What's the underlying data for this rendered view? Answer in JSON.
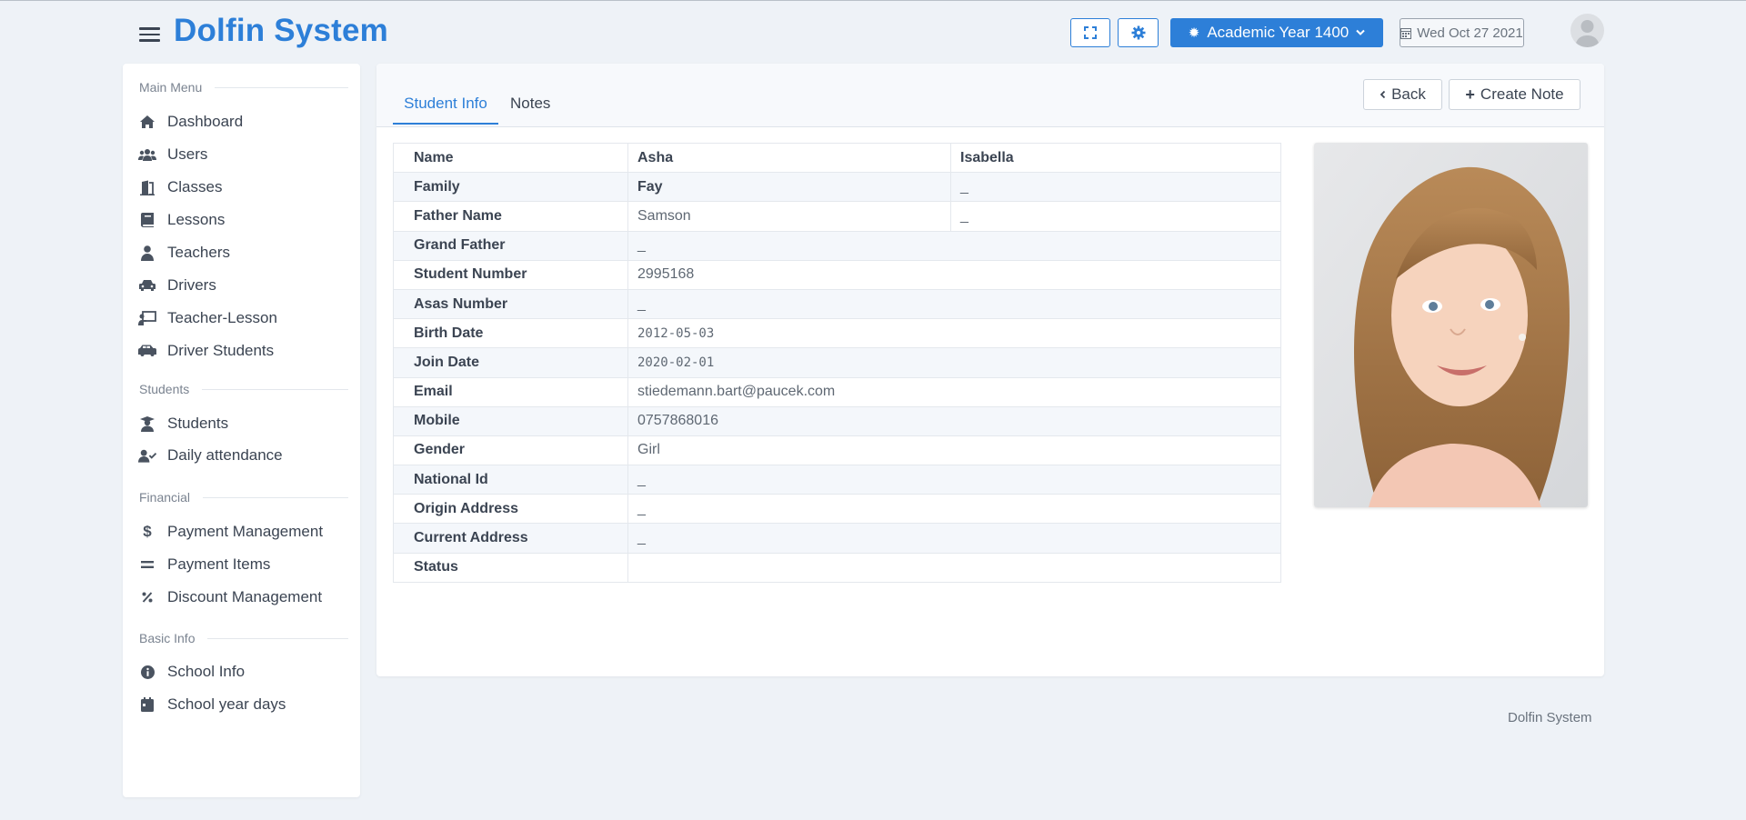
{
  "header": {
    "brand": "Dolfin System",
    "academic_year": "Academic Year 1400",
    "date": "Wed Oct 27 2021"
  },
  "sidebar": {
    "sections": [
      {
        "title": "Main Menu",
        "items": [
          {
            "label": "Dashboard",
            "icon": "home-icon"
          },
          {
            "label": "Users",
            "icon": "users-icon"
          },
          {
            "label": "Classes",
            "icon": "door-icon"
          },
          {
            "label": "Lessons",
            "icon": "book-icon"
          },
          {
            "label": "Teachers",
            "icon": "teacher-icon"
          },
          {
            "label": "Drivers",
            "icon": "car-icon"
          },
          {
            "label": "Teacher-Lesson",
            "icon": "chalkboard-icon"
          },
          {
            "label": "Driver Students",
            "icon": "bus-icon"
          }
        ]
      },
      {
        "title": "Students",
        "items": [
          {
            "label": "Students",
            "icon": "graduate-icon"
          },
          {
            "label": "Daily attendance",
            "icon": "user-check-icon"
          }
        ]
      },
      {
        "title": "Financial",
        "items": [
          {
            "label": "Payment Management",
            "icon": "dollar-icon"
          },
          {
            "label": "Payment Items",
            "icon": "equals-icon"
          },
          {
            "label": "Discount Management",
            "icon": "percent-icon"
          }
        ]
      },
      {
        "title": "Basic Info",
        "items": [
          {
            "label": "School Info",
            "icon": "info-icon"
          },
          {
            "label": "School year days",
            "icon": "calendar-icon"
          }
        ]
      }
    ]
  },
  "tabs": {
    "student_info": "Student Info",
    "notes": "Notes"
  },
  "actions": {
    "back": "Back",
    "create_note": "Create Note"
  },
  "info": {
    "name_label": "Name",
    "first_name": "Asha",
    "first_name_2": "Isabella",
    "family_label": "Family",
    "family": "Fay",
    "family_2": "_",
    "father_label": "Father Name",
    "father": "Samson",
    "father_2": "_",
    "grandfather_label": "Grand Father",
    "grandfather": "_",
    "student_number_label": "Student Number",
    "student_number": "2995168",
    "asas_label": "Asas Number",
    "asas": "_",
    "birth_label": "Birth Date",
    "birth": "2012-05-03",
    "join_label": "Join Date",
    "join": "2020-02-01",
    "email_label": "Email",
    "email": "stiedemann.bart@paucek.com",
    "mobile_label": "Mobile",
    "mobile": "0757868016",
    "gender_label": "Gender",
    "gender": "Girl",
    "national_label": "National Id",
    "national": "_",
    "origin_label": "Origin Address",
    "origin": "_",
    "current_label": "Current Address",
    "current": "_",
    "status_label": "Status",
    "status": ""
  },
  "footer": {
    "text": "Dolfin System"
  }
}
